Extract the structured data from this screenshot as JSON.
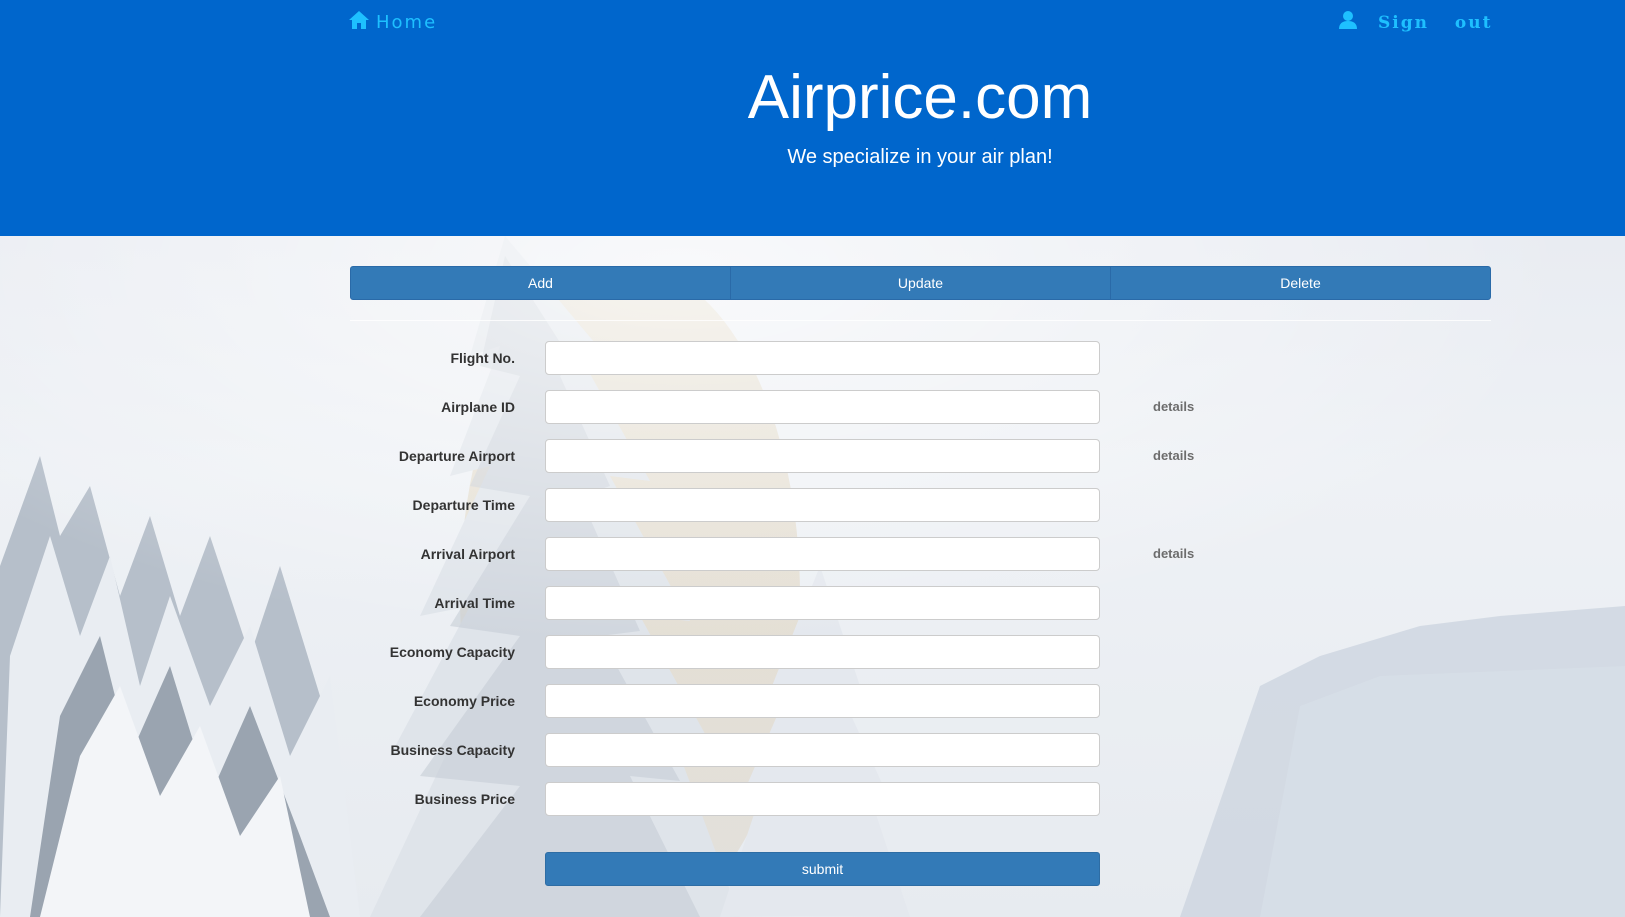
{
  "nav": {
    "home_label": "Home",
    "home_icon": "home-icon",
    "user_icon": "user-icon",
    "signout_label": "Sign out"
  },
  "brand": {
    "title": "Airprice.com",
    "subtitle": "We specialize in your air plan!"
  },
  "tabs": [
    "Add",
    "Update",
    "Delete"
  ],
  "form": {
    "fields": [
      {
        "label": "Flight No.",
        "value": "",
        "details": ""
      },
      {
        "label": "Airplane ID",
        "value": "",
        "details": "details"
      },
      {
        "label": "Departure Airport",
        "value": "",
        "details": "details"
      },
      {
        "label": "Departure Time",
        "value": "",
        "details": ""
      },
      {
        "label": "Arrival Airport",
        "value": "",
        "details": "details"
      },
      {
        "label": "Arrival Time",
        "value": "",
        "details": ""
      },
      {
        "label": "Economy Capacity",
        "value": "",
        "details": ""
      },
      {
        "label": "Economy Price",
        "value": "",
        "details": ""
      },
      {
        "label": "Business Capacity",
        "value": "",
        "details": ""
      },
      {
        "label": "Business Price",
        "value": "",
        "details": ""
      }
    ],
    "submit_label": "submit"
  },
  "colors": {
    "header": "#0066cc",
    "nav_link": "#1ec0ff",
    "button": "#337ab7"
  }
}
